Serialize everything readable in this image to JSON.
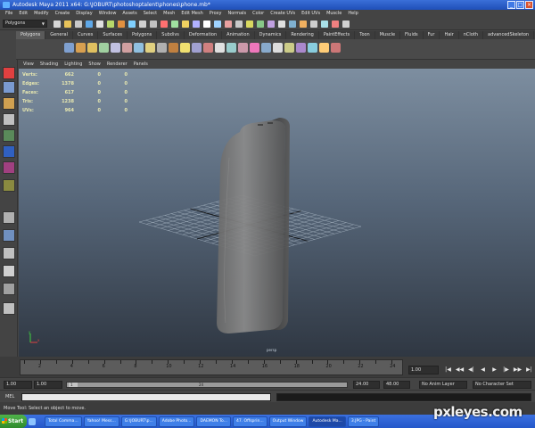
{
  "window": {
    "title": "Autodesk Maya 2011 x64: G:\\JOBURT\\photoshoptalent\\phones\\phone.mb*",
    "minimize": "_",
    "maximize": "□",
    "close": "×"
  },
  "menubar": [
    "File",
    "Edit",
    "Modify",
    "Create",
    "Display",
    "Window",
    "Assets",
    "Select",
    "Mesh",
    "Edit Mesh",
    "Proxy",
    "Normals",
    "Color",
    "Create UVs",
    "Edit UVs",
    "Muscle",
    "Help"
  ],
  "statusline": {
    "mode": "Polygons"
  },
  "shelf_tabs": [
    "Polygons",
    "General",
    "Curves",
    "Surfaces",
    "Polygons",
    "Subdivs",
    "Deformation",
    "Animation",
    "Dynamics",
    "Rendering",
    "PaintEffects",
    "Toon",
    "Muscle",
    "Fluids",
    "Fur",
    "Hair",
    "nCloth",
    "advancedSkeleton"
  ],
  "view_menu": [
    "View",
    "Shading",
    "Lighting",
    "Show",
    "Renderer",
    "Panels"
  ],
  "hud": {
    "rows": [
      {
        "label": "Verts:",
        "value": "662",
        "sel": "0",
        "comp": "0"
      },
      {
        "label": "Edges:",
        "value": "1378",
        "sel": "0",
        "comp": "0"
      },
      {
        "label": "Faces:",
        "value": "617",
        "sel": "0",
        "comp": "0"
      },
      {
        "label": "Tris:",
        "value": "1238",
        "sel": "0",
        "comp": "0"
      },
      {
        "label": "UVs:",
        "value": "964",
        "sel": "0",
        "comp": "0"
      }
    ]
  },
  "viewport": {
    "camera": "persp",
    "axis_y": "y",
    "axis_x": "x"
  },
  "timeline": {
    "ticks": [
      "2",
      "4",
      "6",
      "8",
      "10",
      "12",
      "14",
      "16",
      "18",
      "20",
      "22",
      "24"
    ],
    "current_frame": "1.00",
    "play_buttons": [
      "|◀",
      "◀◀",
      "◀|",
      "◀",
      "▶",
      "|▶",
      "▶▶",
      "▶|"
    ]
  },
  "range": {
    "start": "1.00",
    "inner_start": "1.00",
    "slider_left": "1",
    "slider_right": "24",
    "inner_end": "24.00",
    "end": "48.00",
    "anim_layer": "No Anim Layer",
    "character_set": "No Character Set"
  },
  "mel": {
    "label": "MEL"
  },
  "help": {
    "text": "Move Tool: Select an object to move."
  },
  "taskbar": {
    "start": "Start",
    "tasks": [
      "Total Comma...",
      "Yahoo! Mess...",
      "G:\\JOBURT\\p...",
      "Adobe Photo...",
      "DAEMON To...",
      "47. Offsprin...",
      "Output Window",
      "Autodesk Ma...",
      "3.JPG - Paint"
    ],
    "active_index": 7
  },
  "watermark": "pxleyes.com"
}
